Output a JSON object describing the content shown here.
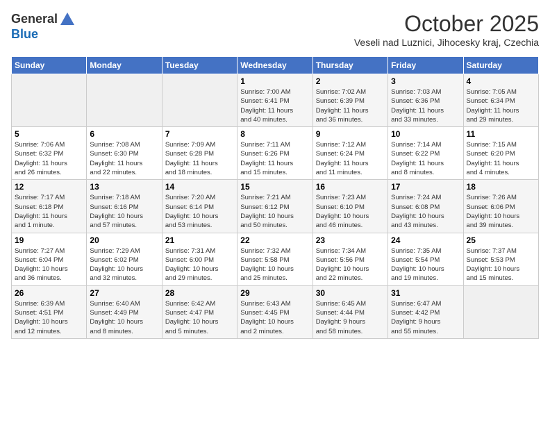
{
  "header": {
    "logo_general": "General",
    "logo_blue": "Blue",
    "month_title": "October 2025",
    "location": "Veseli nad Luznici, Jihocesky kraj, Czechia"
  },
  "weekdays": [
    "Sunday",
    "Monday",
    "Tuesday",
    "Wednesday",
    "Thursday",
    "Friday",
    "Saturday"
  ],
  "weeks": [
    [
      {
        "day": "",
        "info": ""
      },
      {
        "day": "",
        "info": ""
      },
      {
        "day": "",
        "info": ""
      },
      {
        "day": "1",
        "info": "Sunrise: 7:00 AM\nSunset: 6:41 PM\nDaylight: 11 hours\nand 40 minutes."
      },
      {
        "day": "2",
        "info": "Sunrise: 7:02 AM\nSunset: 6:39 PM\nDaylight: 11 hours\nand 36 minutes."
      },
      {
        "day": "3",
        "info": "Sunrise: 7:03 AM\nSunset: 6:36 PM\nDaylight: 11 hours\nand 33 minutes."
      },
      {
        "day": "4",
        "info": "Sunrise: 7:05 AM\nSunset: 6:34 PM\nDaylight: 11 hours\nand 29 minutes."
      }
    ],
    [
      {
        "day": "5",
        "info": "Sunrise: 7:06 AM\nSunset: 6:32 PM\nDaylight: 11 hours\nand 26 minutes."
      },
      {
        "day": "6",
        "info": "Sunrise: 7:08 AM\nSunset: 6:30 PM\nDaylight: 11 hours\nand 22 minutes."
      },
      {
        "day": "7",
        "info": "Sunrise: 7:09 AM\nSunset: 6:28 PM\nDaylight: 11 hours\nand 18 minutes."
      },
      {
        "day": "8",
        "info": "Sunrise: 7:11 AM\nSunset: 6:26 PM\nDaylight: 11 hours\nand 15 minutes."
      },
      {
        "day": "9",
        "info": "Sunrise: 7:12 AM\nSunset: 6:24 PM\nDaylight: 11 hours\nand 11 minutes."
      },
      {
        "day": "10",
        "info": "Sunrise: 7:14 AM\nSunset: 6:22 PM\nDaylight: 11 hours\nand 8 minutes."
      },
      {
        "day": "11",
        "info": "Sunrise: 7:15 AM\nSunset: 6:20 PM\nDaylight: 11 hours\nand 4 minutes."
      }
    ],
    [
      {
        "day": "12",
        "info": "Sunrise: 7:17 AM\nSunset: 6:18 PM\nDaylight: 11 hours\nand 1 minute."
      },
      {
        "day": "13",
        "info": "Sunrise: 7:18 AM\nSunset: 6:16 PM\nDaylight: 10 hours\nand 57 minutes."
      },
      {
        "day": "14",
        "info": "Sunrise: 7:20 AM\nSunset: 6:14 PM\nDaylight: 10 hours\nand 53 minutes."
      },
      {
        "day": "15",
        "info": "Sunrise: 7:21 AM\nSunset: 6:12 PM\nDaylight: 10 hours\nand 50 minutes."
      },
      {
        "day": "16",
        "info": "Sunrise: 7:23 AM\nSunset: 6:10 PM\nDaylight: 10 hours\nand 46 minutes."
      },
      {
        "day": "17",
        "info": "Sunrise: 7:24 AM\nSunset: 6:08 PM\nDaylight: 10 hours\nand 43 minutes."
      },
      {
        "day": "18",
        "info": "Sunrise: 7:26 AM\nSunset: 6:06 PM\nDaylight: 10 hours\nand 39 minutes."
      }
    ],
    [
      {
        "day": "19",
        "info": "Sunrise: 7:27 AM\nSunset: 6:04 PM\nDaylight: 10 hours\nand 36 minutes."
      },
      {
        "day": "20",
        "info": "Sunrise: 7:29 AM\nSunset: 6:02 PM\nDaylight: 10 hours\nand 32 minutes."
      },
      {
        "day": "21",
        "info": "Sunrise: 7:31 AM\nSunset: 6:00 PM\nDaylight: 10 hours\nand 29 minutes."
      },
      {
        "day": "22",
        "info": "Sunrise: 7:32 AM\nSunset: 5:58 PM\nDaylight: 10 hours\nand 25 minutes."
      },
      {
        "day": "23",
        "info": "Sunrise: 7:34 AM\nSunset: 5:56 PM\nDaylight: 10 hours\nand 22 minutes."
      },
      {
        "day": "24",
        "info": "Sunrise: 7:35 AM\nSunset: 5:54 PM\nDaylight: 10 hours\nand 19 minutes."
      },
      {
        "day": "25",
        "info": "Sunrise: 7:37 AM\nSunset: 5:53 PM\nDaylight: 10 hours\nand 15 minutes."
      }
    ],
    [
      {
        "day": "26",
        "info": "Sunrise: 6:39 AM\nSunset: 4:51 PM\nDaylight: 10 hours\nand 12 minutes."
      },
      {
        "day": "27",
        "info": "Sunrise: 6:40 AM\nSunset: 4:49 PM\nDaylight: 10 hours\nand 8 minutes."
      },
      {
        "day": "28",
        "info": "Sunrise: 6:42 AM\nSunset: 4:47 PM\nDaylight: 10 hours\nand 5 minutes."
      },
      {
        "day": "29",
        "info": "Sunrise: 6:43 AM\nSunset: 4:45 PM\nDaylight: 10 hours\nand 2 minutes."
      },
      {
        "day": "30",
        "info": "Sunrise: 6:45 AM\nSunset: 4:44 PM\nDaylight: 9 hours\nand 58 minutes."
      },
      {
        "day": "31",
        "info": "Sunrise: 6:47 AM\nSunset: 4:42 PM\nDaylight: 9 hours\nand 55 minutes."
      },
      {
        "day": "",
        "info": ""
      }
    ]
  ]
}
